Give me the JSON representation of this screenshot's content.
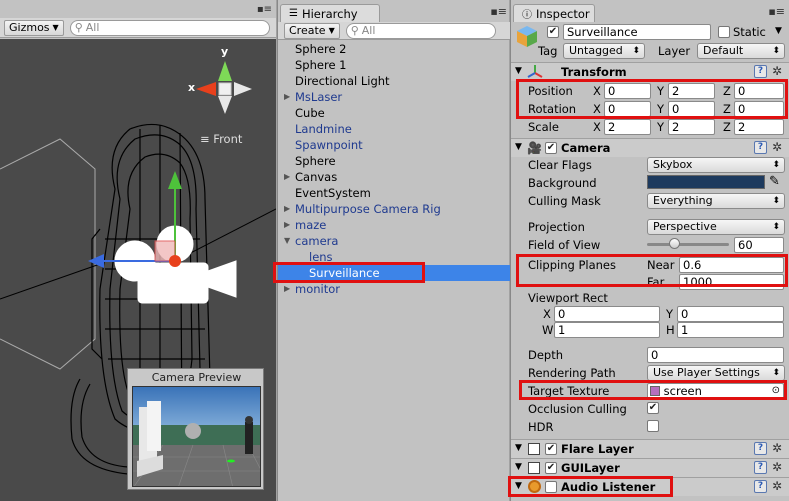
{
  "scene": {
    "gizmos_label": "Gizmos",
    "search_placeholder": "All",
    "view_label": "Front",
    "gizmo_axis_y": "y",
    "gizmo_axis_x": "x",
    "preview_title": "Camera Preview"
  },
  "hierarchy": {
    "tab_label": "Hierarchy",
    "create_label": "Create",
    "search_placeholder": "All",
    "items": [
      {
        "label": "Sphere 2",
        "blue": false,
        "indent": 0,
        "arrow": ""
      },
      {
        "label": "Sphere 1",
        "blue": false,
        "indent": 0,
        "arrow": ""
      },
      {
        "label": "Directional Light",
        "blue": false,
        "indent": 0,
        "arrow": ""
      },
      {
        "label": "MsLaser",
        "blue": true,
        "indent": 0,
        "arrow": "right"
      },
      {
        "label": "Cube",
        "blue": false,
        "indent": 0,
        "arrow": ""
      },
      {
        "label": "Landmine",
        "blue": true,
        "indent": 0,
        "arrow": ""
      },
      {
        "label": "Spawnpoint",
        "blue": true,
        "indent": 0,
        "arrow": ""
      },
      {
        "label": "Sphere",
        "blue": false,
        "indent": 0,
        "arrow": ""
      },
      {
        "label": "Canvas",
        "blue": false,
        "indent": 0,
        "arrow": "right"
      },
      {
        "label": "EventSystem",
        "blue": false,
        "indent": 0,
        "arrow": ""
      },
      {
        "label": "Multipurpose Camera Rig",
        "blue": true,
        "indent": 0,
        "arrow": "right"
      },
      {
        "label": "maze",
        "blue": true,
        "indent": 0,
        "arrow": "right"
      },
      {
        "label": "camera",
        "blue": true,
        "indent": 0,
        "arrow": "down"
      },
      {
        "label": "lens",
        "blue": true,
        "indent": 1,
        "arrow": ""
      },
      {
        "label": "Surveillance",
        "blue": true,
        "indent": 1,
        "arrow": "",
        "selected": true
      },
      {
        "label": "monitor",
        "blue": true,
        "indent": 0,
        "arrow": "right"
      }
    ]
  },
  "inspector": {
    "tab_label": "Inspector",
    "object_name": "Surveillance",
    "static_label": "Static",
    "tag_label": "Tag",
    "tag_value": "Untagged",
    "layer_label": "Layer",
    "layer_value": "Default",
    "transform": {
      "title": "Transform",
      "position_label": "Position",
      "position": {
        "x": "0",
        "y": "2",
        "z": "0"
      },
      "rotation_label": "Rotation",
      "rotation": {
        "x": "0",
        "y": "0",
        "z": "0"
      },
      "scale_label": "Scale",
      "scale": {
        "x": "2",
        "y": "2",
        "z": "2"
      },
      "axis_x": "X",
      "axis_y": "Y",
      "axis_z": "Z"
    },
    "camera": {
      "title": "Camera",
      "clear_flags_label": "Clear Flags",
      "clear_flags_value": "Skybox",
      "background_label": "Background",
      "background_color": "#1d3a5e",
      "culling_mask_label": "Culling Mask",
      "culling_mask_value": "Everything",
      "projection_label": "Projection",
      "projection_value": "Perspective",
      "fov_label": "Field of View",
      "fov_value": "60",
      "fov_fraction": 0.33,
      "clipping_label": "Clipping Planes",
      "near_label": "Near",
      "near_value": "0.6",
      "far_label": "Far",
      "far_value": "1000",
      "viewport_label": "Viewport Rect",
      "vp_x_label": "X",
      "vp_x": "0",
      "vp_y_label": "Y",
      "vp_y": "0",
      "vp_w_label": "W",
      "vp_w": "1",
      "vp_h_label": "H",
      "vp_h": "1",
      "depth_label": "Depth",
      "depth_value": "0",
      "rendering_path_label": "Rendering Path",
      "rendering_path_value": "Use Player Settings",
      "target_texture_label": "Target Texture",
      "target_texture_value": "screen",
      "occlusion_label": "Occlusion Culling",
      "hdr_label": "HDR"
    },
    "flare_layer_title": "Flare Layer",
    "gui_layer_title": "GUILayer",
    "audio_listener_title": "Audio Listener"
  },
  "colors": {
    "selection": "#3d84e8",
    "highlight_box": "#e01010",
    "scene_bg": "#4a4a4a"
  }
}
